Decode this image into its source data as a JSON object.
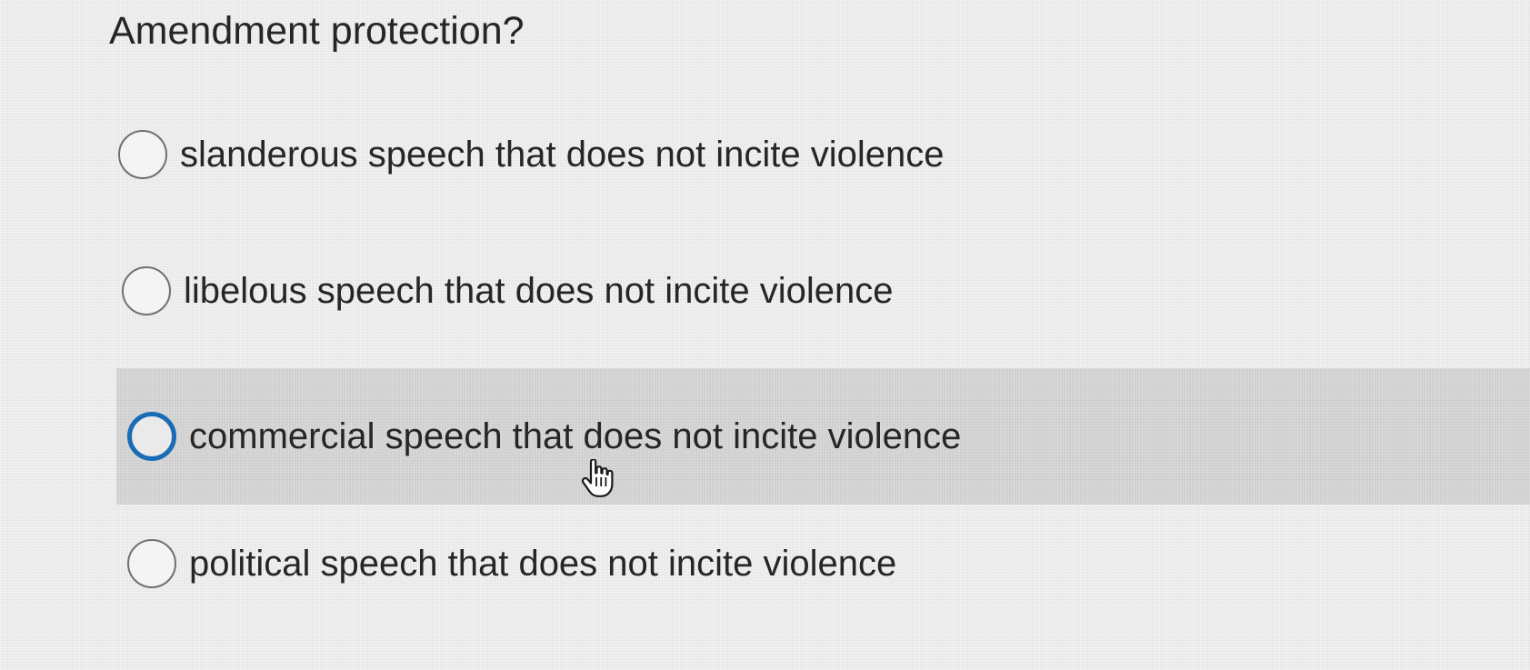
{
  "question": {
    "text": "Amendment protection?"
  },
  "options": [
    {
      "label": "slanderous speech that does not incite violence",
      "selected": false
    },
    {
      "label": "libelous speech that does not incite violence",
      "selected": false
    },
    {
      "label": "commercial speech that does not incite violence",
      "selected": false,
      "hovered": true
    },
    {
      "label": "political speech that does not incite violence",
      "selected": false
    }
  ],
  "cursor": {
    "icon": "hand-pointer-icon"
  },
  "colors": {
    "background": "#ececec",
    "hover_row": "#d3d3d3",
    "radio_focus": "#1a6db5",
    "text": "#262626"
  }
}
